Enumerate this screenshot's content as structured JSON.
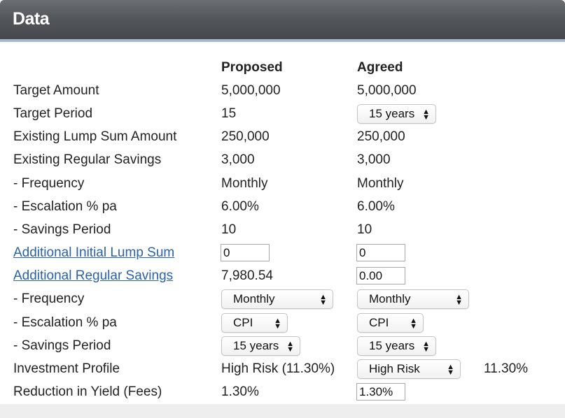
{
  "header": {
    "title": "Data"
  },
  "columns": {
    "proposed": "Proposed",
    "agreed": "Agreed"
  },
  "rows": {
    "target_amount": {
      "label": "Target Amount",
      "proposed": "5,000,000",
      "agreed": "5,000,000"
    },
    "target_period": {
      "label": "Target Period",
      "proposed": "15",
      "agreed": "15 years"
    },
    "existing_lump_sum": {
      "label": "Existing Lump Sum Amount",
      "proposed": "250,000",
      "agreed": "250,000"
    },
    "existing_regular_savings": {
      "label": "Existing Regular Savings",
      "proposed": "3,000",
      "agreed": "3,000"
    },
    "existing_frequency": {
      "label": "- Frequency",
      "proposed": "Monthly",
      "agreed": "Monthly"
    },
    "existing_escalation": {
      "label": "- Escalation % pa",
      "proposed": "6.00%",
      "agreed": "6.00%"
    },
    "existing_savings_period": {
      "label": "- Savings Period",
      "proposed": "10",
      "agreed": "10"
    },
    "additional_lump_sum": {
      "label": "Additional Initial Lump Sum",
      "proposed": "0",
      "agreed": "0"
    },
    "additional_regular_savings": {
      "label": "Additional Regular Savings",
      "proposed": "7,980.54",
      "agreed": "0.00"
    },
    "additional_frequency": {
      "label": "- Frequency",
      "proposed": "Monthly",
      "agreed": "Monthly"
    },
    "additional_escalation": {
      "label": "- Escalation % pa",
      "proposed": "CPI",
      "agreed": "CPI"
    },
    "additional_savings_period": {
      "label": "- Savings Period",
      "proposed": "15 years",
      "agreed": "15 years"
    },
    "investment_profile": {
      "label": "Investment Profile",
      "proposed": "High Risk (11.30%)",
      "agreed": "High Risk",
      "agreed_rate": "11.30%"
    },
    "reduction_in_yield": {
      "label": "Reduction in Yield (Fees)",
      "proposed": "1.30%",
      "agreed": "1.30%"
    }
  },
  "icons": {
    "select_arrows": "up-down-chevron-icon"
  },
  "colors": {
    "header_bg": "#54575c",
    "header_border": "#a7b9c9",
    "link": "#2a62a8"
  }
}
